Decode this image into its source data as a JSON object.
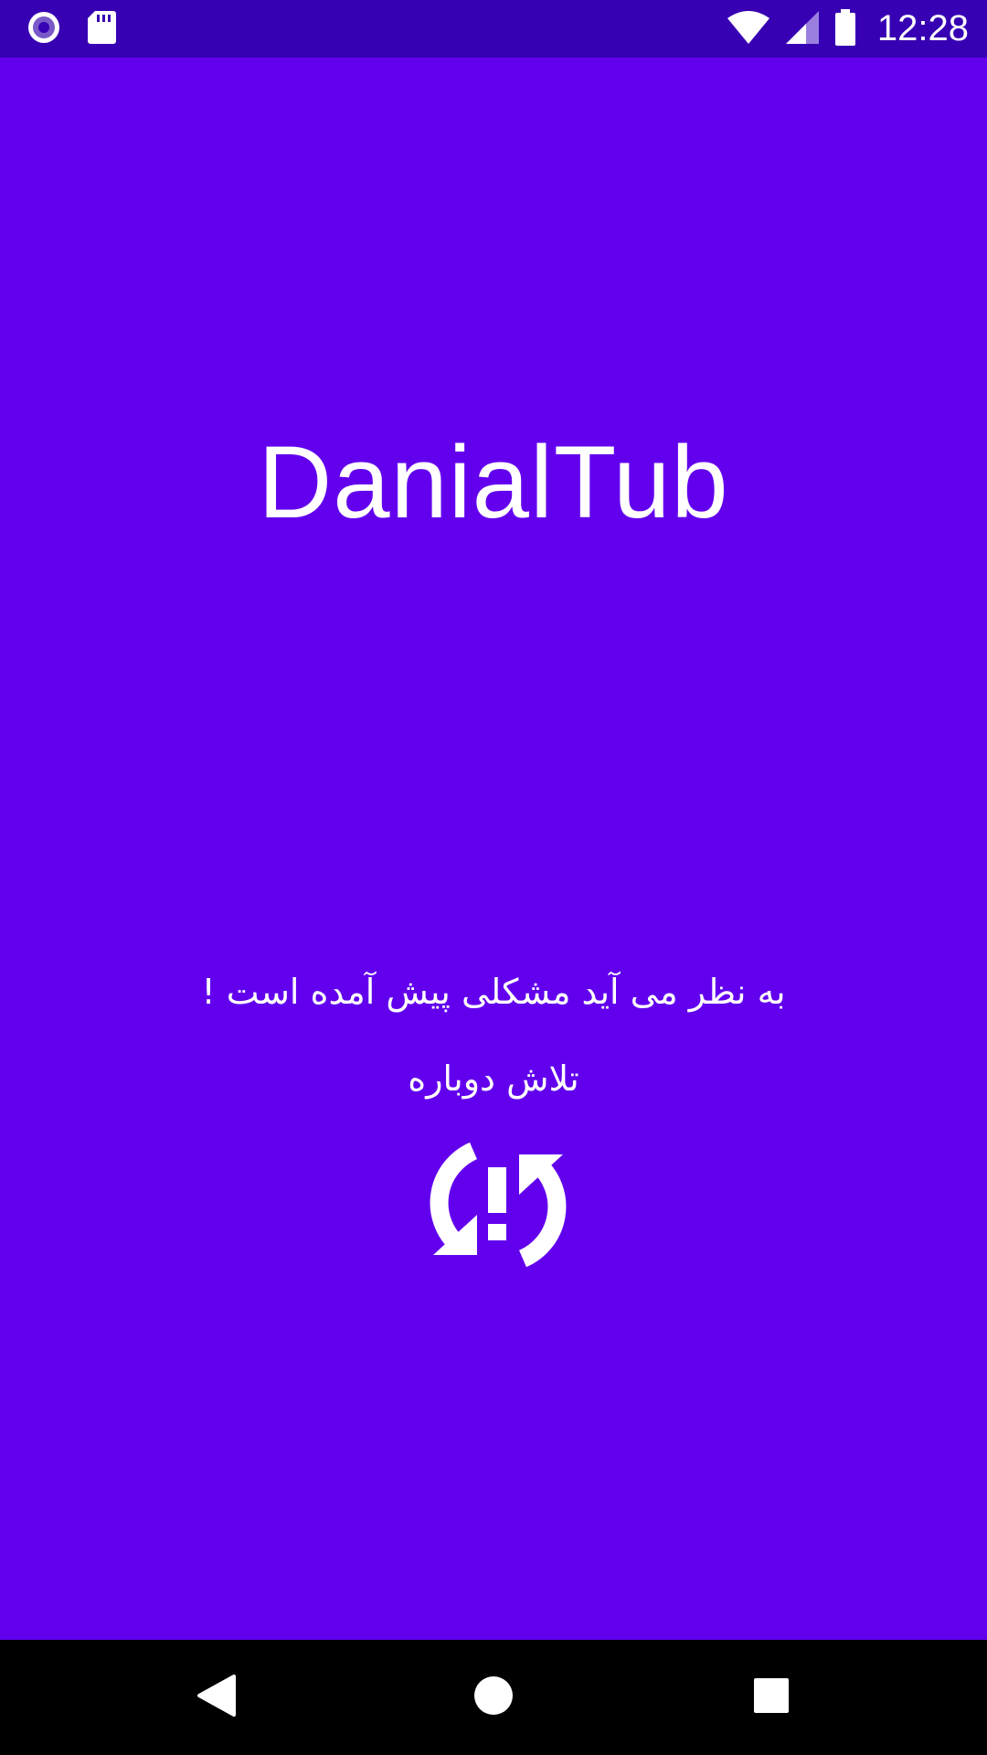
{
  "status_bar": {
    "time": "12:28",
    "left_icons": [
      "radio-button-icon",
      "sd-card-icon"
    ],
    "right_icons": [
      "wifi-icon",
      "cellular-signal-icon",
      "battery-icon"
    ]
  },
  "main": {
    "app_title": "DanialTub",
    "error_message": "به نظر می آید مشکلی پیش آمده است !",
    "retry_label": "تلاش دوباره",
    "retry_icon": "sync-problem-icon"
  },
  "nav_bar": {
    "buttons": [
      "back-icon",
      "home-icon",
      "recents-icon"
    ]
  },
  "colors": {
    "background": "#6200EE",
    "status_bar": "#3700B3",
    "nav_bar": "#000000",
    "foreground": "#FFFFFF"
  }
}
